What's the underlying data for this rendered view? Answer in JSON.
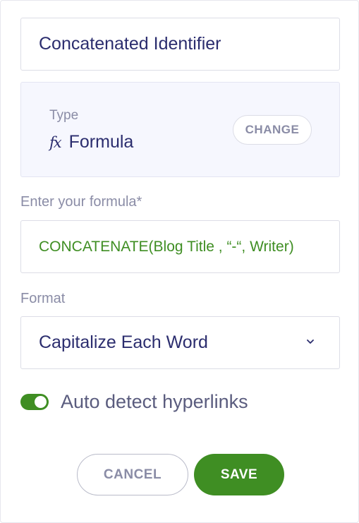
{
  "field_name": {
    "value": "Concatenated Identifier"
  },
  "type_section": {
    "label": "Type",
    "icon": "formula-fx-icon",
    "value": "Formula",
    "change_label": "CHANGE"
  },
  "formula": {
    "label": "Enter your formula*",
    "value": "CONCATENATE(Blog Title , “-“, Writer)"
  },
  "format": {
    "label": "Format",
    "selected": "Capitalize Each Word",
    "icon": "chevron-down-icon"
  },
  "hyperlinks": {
    "label": "Auto detect hyperlinks",
    "enabled": true
  },
  "actions": {
    "cancel_label": "CANCEL",
    "save_label": "SAVE"
  },
  "colors": {
    "accent": "#3f8e23",
    "text_primary": "#2b2d6e",
    "text_muted": "#8a8ca6",
    "type_box_bg": "#f6f7fe"
  }
}
